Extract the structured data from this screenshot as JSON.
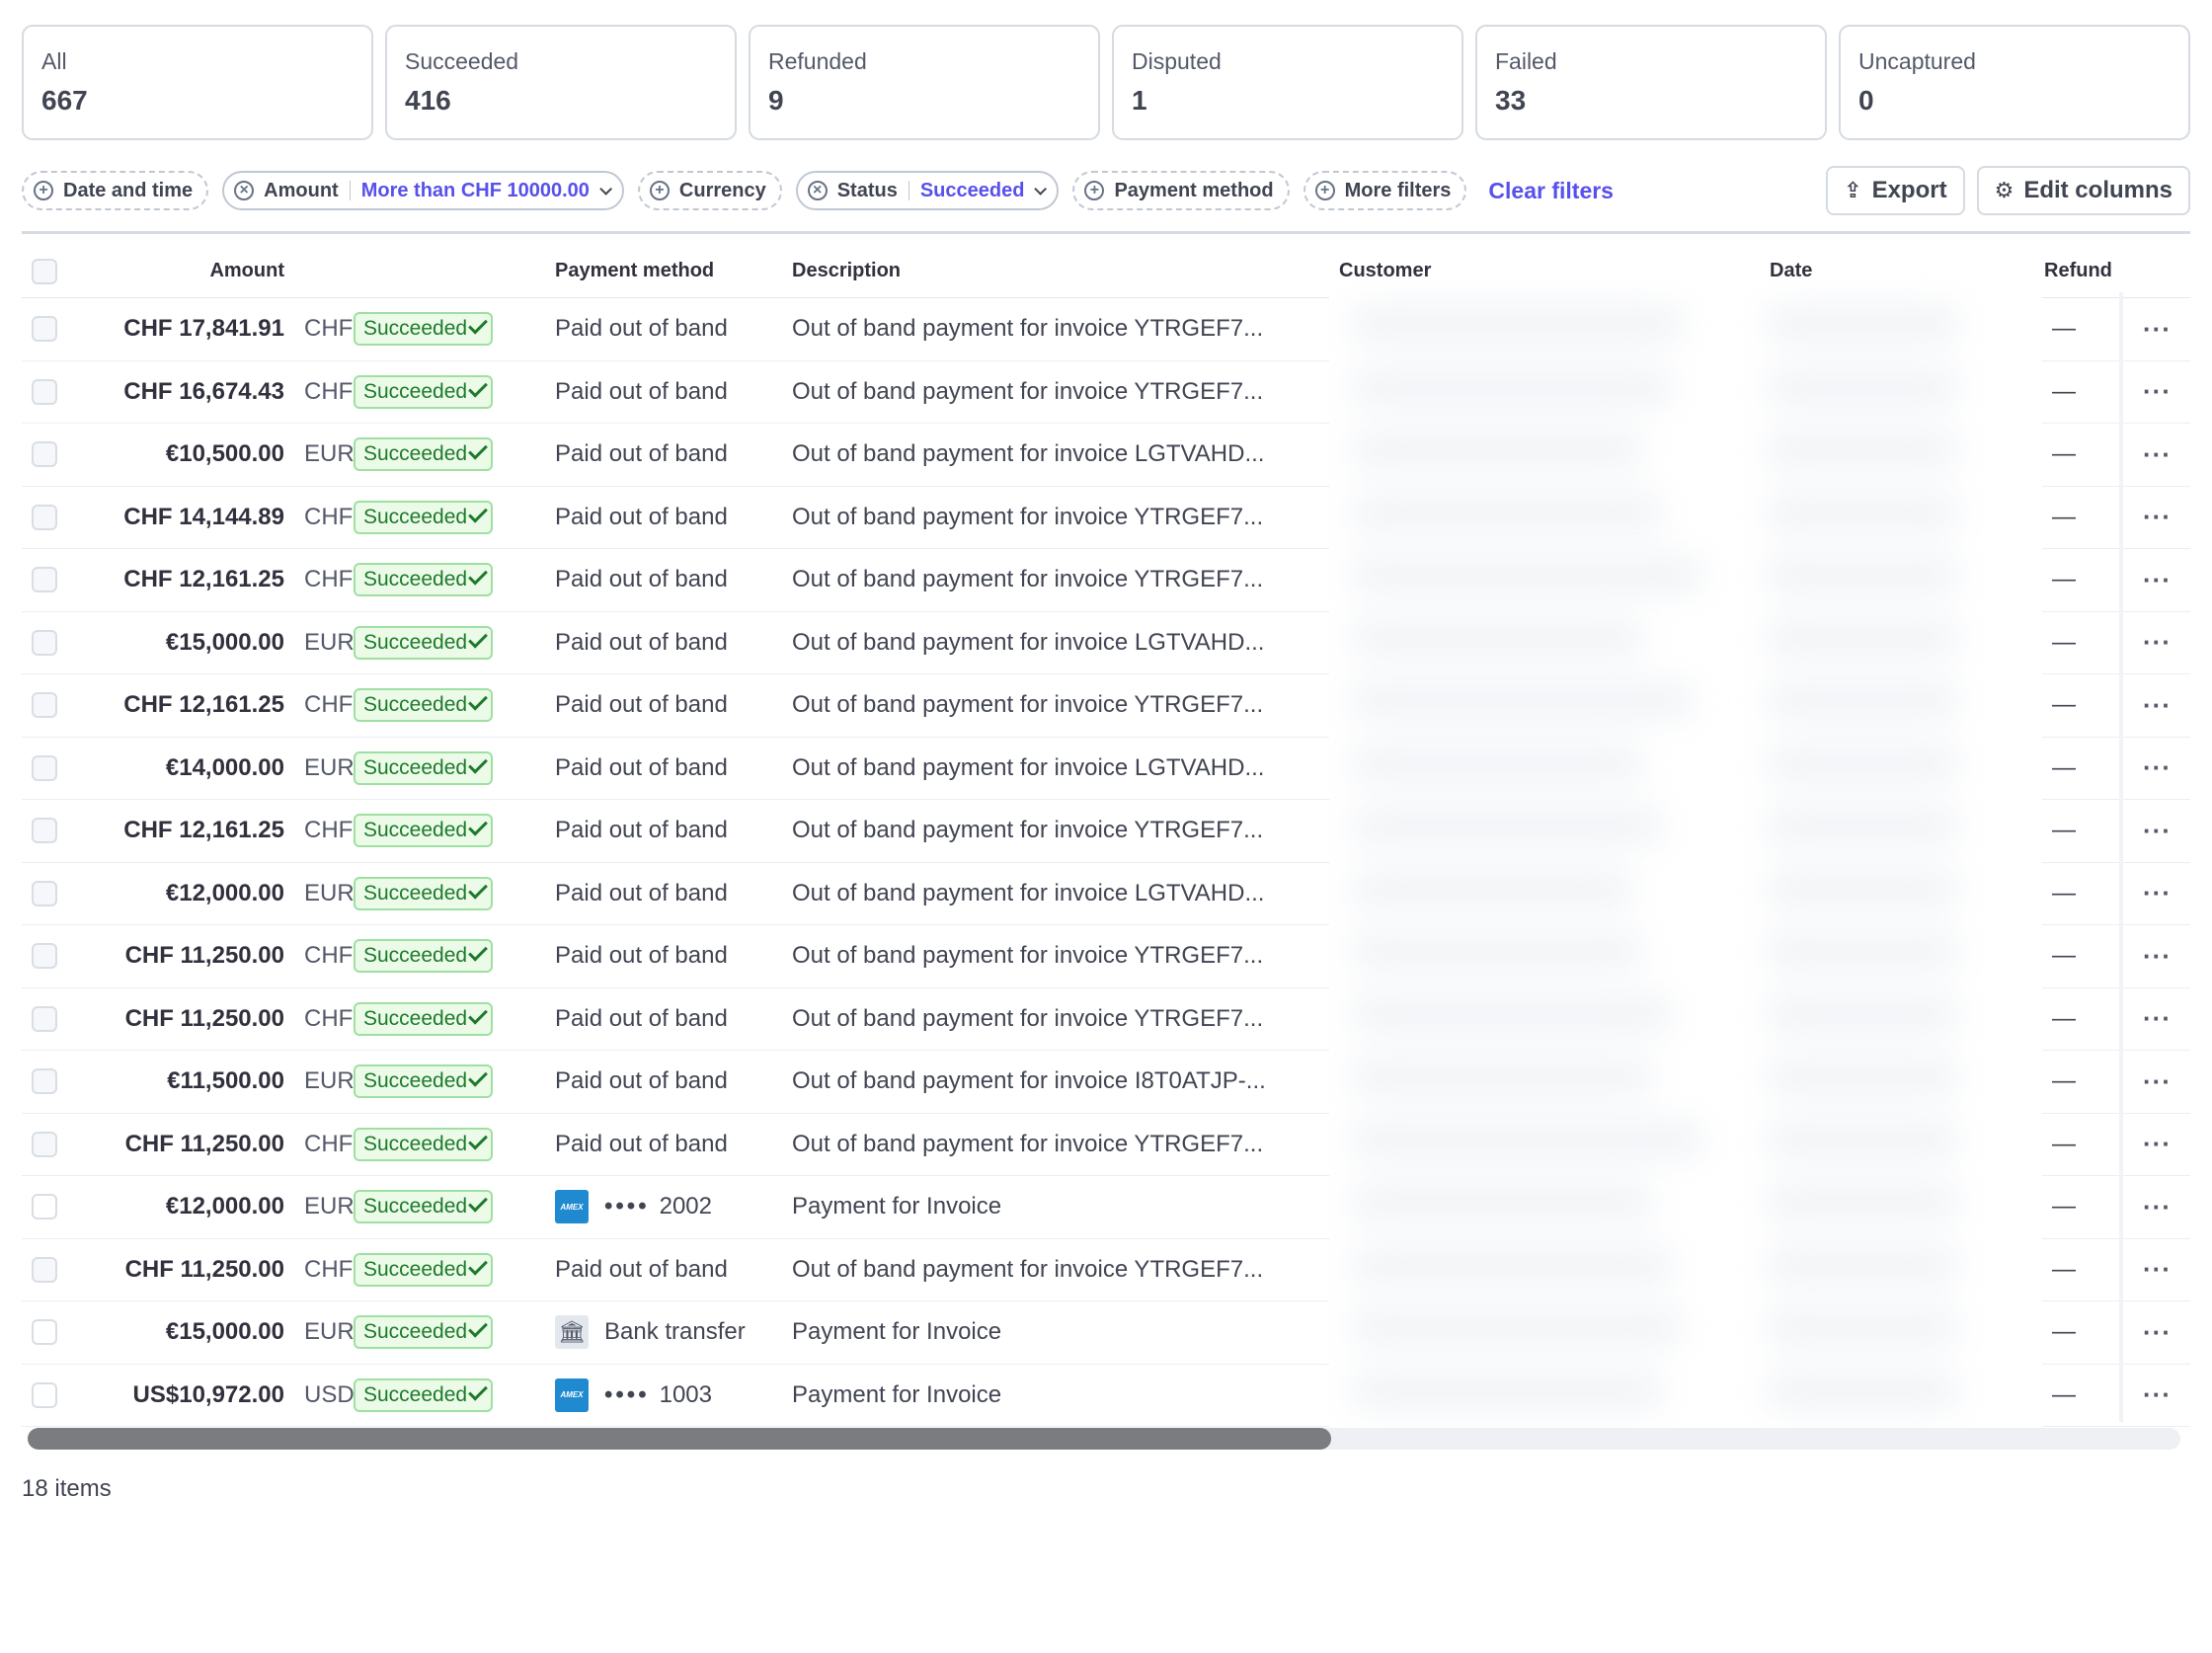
{
  "tabs": [
    {
      "label": "All",
      "count": "667"
    },
    {
      "label": "Succeeded",
      "count": "416"
    },
    {
      "label": "Refunded",
      "count": "9"
    },
    {
      "label": "Disputed",
      "count": "1"
    },
    {
      "label": "Failed",
      "count": "33"
    },
    {
      "label": "Uncaptured",
      "count": "0"
    }
  ],
  "filters": {
    "date_time": "Date and time",
    "amount": "Amount",
    "amount_value": "More than CHF 10000.00",
    "currency": "Currency",
    "status": "Status",
    "status_value": "Succeeded",
    "payment_method": "Payment method",
    "more_filters": "More filters",
    "clear": "Clear filters"
  },
  "actions": {
    "export": "Export",
    "edit_columns": "Edit columns"
  },
  "columns": {
    "amount": "Amount",
    "payment_method": "Payment method",
    "description": "Description",
    "customer": "Customer",
    "date": "Date",
    "refunded": "Refund"
  },
  "rows": [
    {
      "amount": "CHF 17,841.91",
      "currency": "CHF",
      "status": "Succeeded",
      "pm_type": "oob",
      "pm": "Paid out of band",
      "desc": "Out of band payment for invoice YTRGEF7...",
      "refund": "—"
    },
    {
      "amount": "CHF 16,674.43",
      "currency": "CHF",
      "status": "Succeeded",
      "pm_type": "oob",
      "pm": "Paid out of band",
      "desc": "Out of band payment for invoice YTRGEF7...",
      "refund": "—"
    },
    {
      "amount": "€10,500.00",
      "currency": "EUR",
      "status": "Succeeded",
      "pm_type": "oob",
      "pm": "Paid out of band",
      "desc": "Out of band payment for invoice LGTVAHD...",
      "refund": "—"
    },
    {
      "amount": "CHF 14,144.89",
      "currency": "CHF",
      "status": "Succeeded",
      "pm_type": "oob",
      "pm": "Paid out of band",
      "desc": "Out of band payment for invoice YTRGEF7...",
      "refund": "—"
    },
    {
      "amount": "CHF 12,161.25",
      "currency": "CHF",
      "status": "Succeeded",
      "pm_type": "oob",
      "pm": "Paid out of band",
      "desc": "Out of band payment for invoice YTRGEF7...",
      "refund": "—"
    },
    {
      "amount": "€15,000.00",
      "currency": "EUR",
      "status": "Succeeded",
      "pm_type": "oob",
      "pm": "Paid out of band",
      "desc": "Out of band payment for invoice LGTVAHD...",
      "refund": "—"
    },
    {
      "amount": "CHF 12,161.25",
      "currency": "CHF",
      "status": "Succeeded",
      "pm_type": "oob",
      "pm": "Paid out of band",
      "desc": "Out of band payment for invoice YTRGEF7...",
      "refund": "—"
    },
    {
      "amount": "€14,000.00",
      "currency": "EUR",
      "status": "Succeeded",
      "pm_type": "oob",
      "pm": "Paid out of band",
      "desc": "Out of band payment for invoice LGTVAHD...",
      "refund": "—"
    },
    {
      "amount": "CHF 12,161.25",
      "currency": "CHF",
      "status": "Succeeded",
      "pm_type": "oob",
      "pm": "Paid out of band",
      "desc": "Out of band payment for invoice YTRGEF7...",
      "refund": "—"
    },
    {
      "amount": "€12,000.00",
      "currency": "EUR",
      "status": "Succeeded",
      "pm_type": "oob",
      "pm": "Paid out of band",
      "desc": "Out of band payment for invoice LGTVAHD...",
      "refund": "—"
    },
    {
      "amount": "CHF 11,250.00",
      "currency": "CHF",
      "status": "Succeeded",
      "pm_type": "oob",
      "pm": "Paid out of band",
      "desc": "Out of band payment for invoice YTRGEF7...",
      "refund": "—"
    },
    {
      "amount": "CHF 11,250.00",
      "currency": "CHF",
      "status": "Succeeded",
      "pm_type": "oob",
      "pm": "Paid out of band",
      "desc": "Out of band payment for invoice YTRGEF7...",
      "refund": "—"
    },
    {
      "amount": "€11,500.00",
      "currency": "EUR",
      "status": "Succeeded",
      "pm_type": "oob",
      "pm": "Paid out of band",
      "desc": "Out of band payment for invoice I8T0ATJP-...",
      "refund": "—"
    },
    {
      "amount": "CHF 11,250.00",
      "currency": "CHF",
      "status": "Succeeded",
      "pm_type": "oob",
      "pm": "Paid out of band",
      "desc": "Out of band payment for invoice YTRGEF7...",
      "refund": "—"
    },
    {
      "amount": "€12,000.00",
      "currency": "EUR",
      "status": "Succeeded",
      "pm_type": "card",
      "pm": "2002",
      "desc": "Payment for Invoice",
      "refund": "—"
    },
    {
      "amount": "CHF 11,250.00",
      "currency": "CHF",
      "status": "Succeeded",
      "pm_type": "oob",
      "pm": "Paid out of band",
      "desc": "Out of band payment for invoice YTRGEF7...",
      "refund": "—"
    },
    {
      "amount": "€15,000.00",
      "currency": "EUR",
      "status": "Succeeded",
      "pm_type": "bank",
      "pm": "Bank transfer",
      "desc": "Payment for Invoice",
      "refund": "—"
    },
    {
      "amount": "US$10,972.00",
      "currency": "USD",
      "status": "Succeeded",
      "pm_type": "card",
      "pm": "1003",
      "desc": "Payment for Invoice",
      "refund": "—"
    }
  ],
  "card_brand": "AMEX",
  "card_mask": "••••",
  "row_menu": "···",
  "footer": {
    "items_count": "18 items"
  }
}
